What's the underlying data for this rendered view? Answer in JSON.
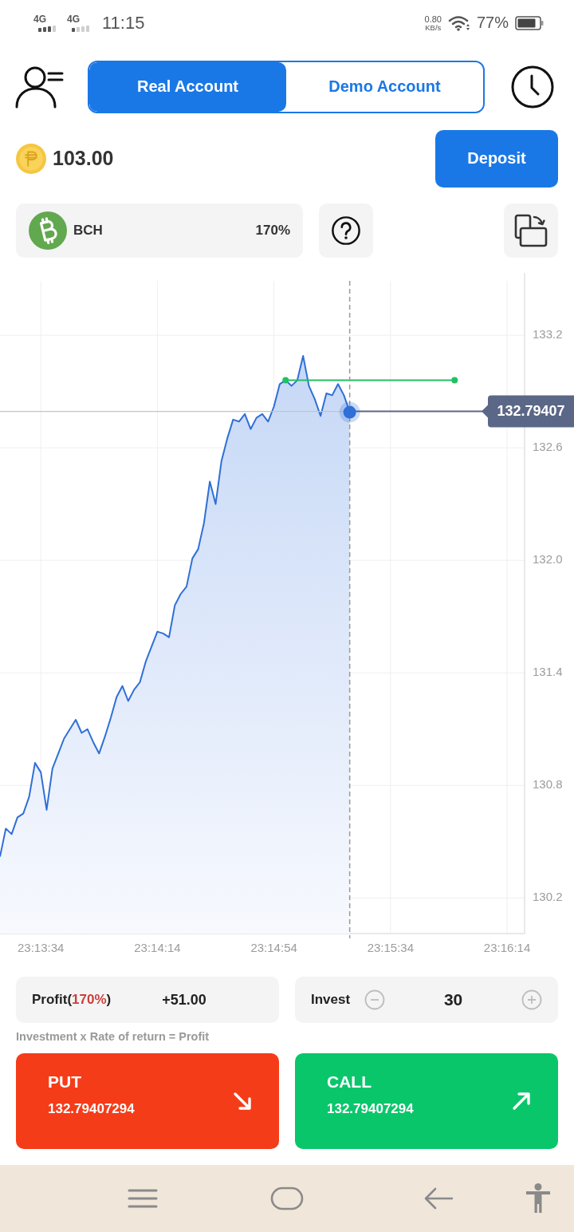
{
  "status_bar": {
    "sim_1": "4G",
    "sim_2": "4G",
    "time": "11:15",
    "net_speed": "0.80",
    "net_speed_unit": "KB/s",
    "battery": "77%"
  },
  "account_tabs": [
    {
      "label": "Real Account",
      "selected": true
    },
    {
      "label": "Demo Account",
      "selected": false
    }
  ],
  "balance": {
    "amount": "103.00"
  },
  "deposit_button": "Deposit",
  "asset": {
    "symbol": "BCH",
    "payout": "170%"
  },
  "chart": {
    "chart_data": {
      "type": "area",
      "grid": true,
      "categories": [
        null,
        null,
        null,
        null,
        null,
        null,
        null,
        "23:13:34",
        null,
        null,
        null,
        null,
        null,
        null,
        null,
        null,
        null,
        null,
        null,
        null,
        null,
        null,
        null,
        null,
        null,
        null,
        null,
        "23:14:14",
        null,
        null,
        null,
        null,
        null,
        null,
        null,
        null,
        null,
        null,
        null,
        null,
        null,
        null,
        null,
        null,
        null,
        null,
        null,
        "23:14:54",
        null,
        null,
        null,
        null,
        null,
        null,
        null,
        null,
        null,
        null,
        null,
        null,
        null,
        null,
        null,
        null,
        null,
        null,
        null,
        "23:15:34",
        null,
        null,
        null,
        null,
        null,
        null,
        null,
        null,
        null,
        null,
        null,
        null,
        null,
        null,
        null,
        null,
        null,
        null,
        null,
        "23:16:14",
        null,
        null,
        null
      ],
      "series": [
        {
          "color": "#2f6fd6",
          "values": [
            130.42,
            130.57,
            130.54,
            130.63,
            130.65,
            130.74,
            130.92,
            130.87,
            130.67,
            130.89,
            130.97,
            131.05,
            131.1,
            131.15,
            131.08,
            131.1,
            131.03,
            130.97,
            131.06,
            131.16,
            131.27,
            131.33,
            131.25,
            131.31,
            131.35,
            131.46,
            131.54,
            131.62,
            131.61,
            131.59,
            131.76,
            131.82,
            131.86,
            132.01,
            132.06,
            132.2,
            132.42,
            132.3,
            132.53,
            132.65,
            132.75,
            132.74,
            132.78,
            132.7,
            132.76,
            132.78,
            132.74,
            132.82,
            132.94,
            132.96,
            132.93,
            132.96,
            133.09,
            132.93,
            132.86,
            132.77,
            132.89,
            132.88,
            132.94,
            132.88,
            132.79,
            null,
            null,
            null,
            null,
            null,
            null,
            null,
            null,
            null,
            null,
            null,
            null,
            null,
            null,
            null,
            null,
            null,
            null,
            null,
            null,
            null,
            null,
            null,
            null,
            null,
            null,
            null,
            null,
            null,
            null
          ]
        },
        {
          "color": "#22c063",
          "type": "line",
          "values": [
            null,
            null,
            null,
            null,
            null,
            null,
            null,
            null,
            null,
            null,
            null,
            null,
            null,
            null,
            null,
            null,
            null,
            null,
            null,
            null,
            null,
            null,
            null,
            null,
            null,
            null,
            null,
            null,
            null,
            null,
            null,
            null,
            null,
            null,
            null,
            null,
            null,
            null,
            null,
            null,
            null,
            null,
            null,
            null,
            null,
            null,
            null,
            null,
            null,
            132.96,
            132.96,
            132.96,
            132.96,
            132.96,
            132.96,
            132.96,
            132.96,
            132.96,
            132.96,
            132.96,
            132.96,
            132.96,
            132.96,
            132.96,
            132.96,
            132.96,
            132.96,
            132.96,
            132.96,
            132.96,
            132.96,
            132.96,
            132.96,
            132.96,
            132.96,
            132.96,
            132.96,
            132.96,
            132.96,
            null,
            null,
            null,
            null,
            null,
            null,
            null,
            null,
            null,
            null,
            null,
            null
          ]
        }
      ],
      "ylim": [
        130.01,
        133.49
      ],
      "yticks": [
        {
          "value": 133.2,
          "label": "133.2"
        },
        {
          "value": 132.6,
          "label": "132.6"
        },
        {
          "value": 132.0,
          "label": "132.0"
        },
        {
          "value": 131.4,
          "label": "131.4"
        },
        {
          "value": 130.8,
          "label": "130.8"
        },
        {
          "value": 130.2,
          "label": "130.2"
        }
      ],
      "ref_lines": [
        {
          "axis": "y",
          "value": 132.79407,
          "label": "132.79407"
        }
      ]
    }
  },
  "profit": {
    "label": "Profit(",
    "rate": "170%",
    "label_end": ")",
    "value": "+51.00"
  },
  "invest": {
    "label": "Invest",
    "value": "30"
  },
  "formula": "Investment x Rate of return = Profit",
  "trade_buttons": [
    {
      "kind": "put",
      "label": "PUT",
      "price": "132.79407294"
    },
    {
      "kind": "call",
      "label": "CALL",
      "price": "132.79407294"
    }
  ]
}
